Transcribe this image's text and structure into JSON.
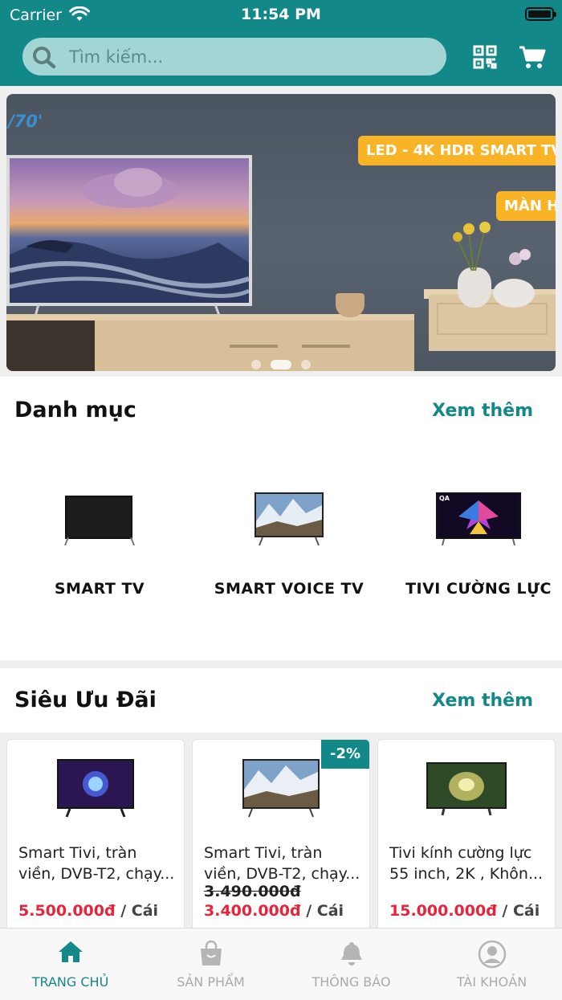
{
  "status_bar": {
    "carrier": "Carrier",
    "time": "11:54 PM"
  },
  "search": {
    "placeholder": "Tìm kiếm..."
  },
  "icons": {
    "search": "search-icon",
    "qr": "qr-code-icon",
    "cart": "cart-icon",
    "home": "home-icon",
    "products": "shopping-bag-icon",
    "notifications": "bell-icon",
    "account": "user-icon"
  },
  "banner": {
    "model_text": "/70'",
    "tag_primary": "LED - 4K HDR SMART TV",
    "tag_secondary": "MÀN H",
    "slide_count": 3,
    "active_slide": 2
  },
  "categories": {
    "title": "Danh mục",
    "see_more": "Xem thêm",
    "items": [
      {
        "label": "SMART TV"
      },
      {
        "label": "SMART VOICE TV"
      },
      {
        "label": "TIVI CƯỜNG LỰC"
      }
    ]
  },
  "deals": {
    "title": "Siêu Ưu Đãi",
    "see_more": "Xem thêm",
    "items": [
      {
        "name": "Smart Tivi, tràn viền, DVB-T2, chạy...",
        "old_price": "",
        "price": "5.500.000đ",
        "unit": " / Cái",
        "discount": ""
      },
      {
        "name": "Smart Tivi, tràn viền, DVB-T2, chạy...",
        "old_price": "3.490.000đ",
        "price": "3.400.000đ",
        "unit": " / Cái",
        "discount": "-2%"
      },
      {
        "name": "Tivi kính cường lực 55 inch, 2K , Khôn...",
        "old_price": "",
        "price": "15.000.000đ",
        "unit": " / Cái",
        "discount": ""
      }
    ]
  },
  "tabbar": {
    "items": [
      {
        "label": "TRANG CHỦ",
        "active": true
      },
      {
        "label": "SẢN PHẨM",
        "active": false
      },
      {
        "label": "THÔNG BÁO",
        "active": false
      },
      {
        "label": "TÀI KHOẢN",
        "active": false
      }
    ]
  },
  "colors": {
    "primary": "#138889",
    "price": "#e8233a",
    "tag": "#f8b326",
    "search_bg": "#a2d5d4"
  }
}
